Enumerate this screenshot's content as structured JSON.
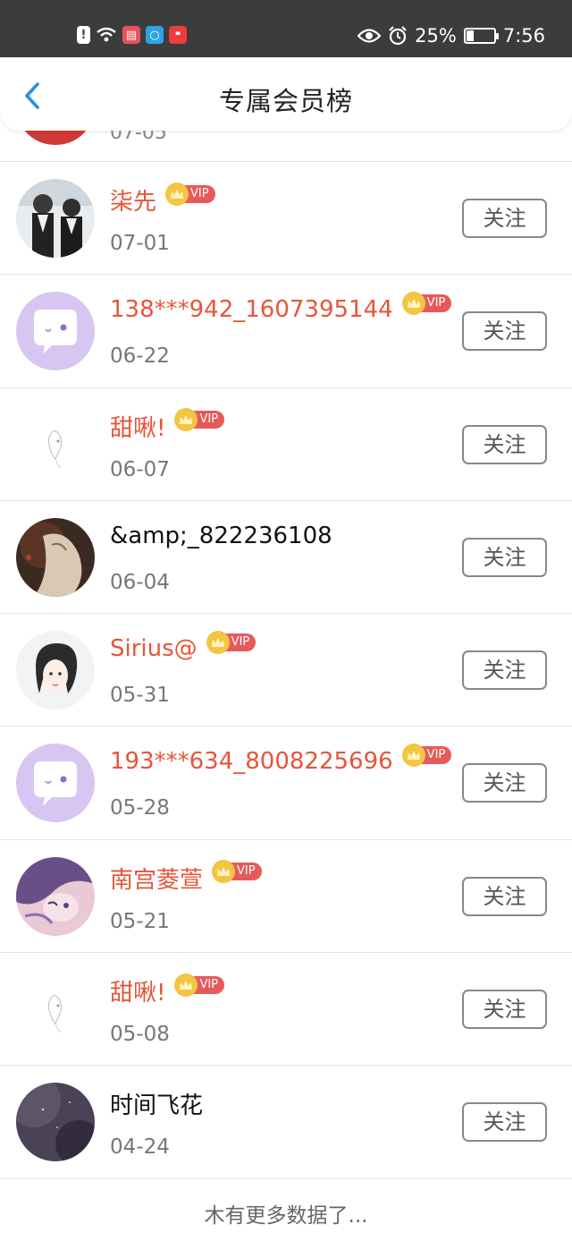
{
  "status_bar": {
    "battery": "25%",
    "time": "7:56",
    "icons": [
      "alert-icon",
      "wifi-icon",
      "app-icon",
      "search-app-icon",
      "huawei-app-icon",
      "eye-icon",
      "alarm-icon",
      "battery-icon"
    ]
  },
  "header": {
    "title": "专属会员榜"
  },
  "partial_row": {
    "date": "07-05"
  },
  "vip_label": "VIP",
  "follow_label": "关注",
  "members": [
    {
      "name": "柒先",
      "date": "07-01",
      "vip": true
    },
    {
      "name": "138***942_1607395144",
      "date": "06-22",
      "vip": true
    },
    {
      "name": "甜啾!",
      "date": "06-07",
      "vip": true
    },
    {
      "name": "&amp;_822236108",
      "date": "06-04",
      "vip": false
    },
    {
      "name": "Sirius@",
      "date": "05-31",
      "vip": true
    },
    {
      "name": "193***634_8008225696",
      "date": "05-28",
      "vip": true
    },
    {
      "name": "南宫菱萱",
      "date": "05-21",
      "vip": true
    },
    {
      "name": "甜啾!",
      "date": "05-08",
      "vip": true
    },
    {
      "name": "时间飞花",
      "date": "04-24",
      "vip": false
    }
  ],
  "footer": {
    "text": "木有更多数据了..."
  },
  "colors": {
    "status_bar": "#3c3c3c",
    "accent_back": "#2a8fe0",
    "vip_name": "#e6553a",
    "vip_badge": "#e65a5a",
    "crown": "#f4c542"
  }
}
